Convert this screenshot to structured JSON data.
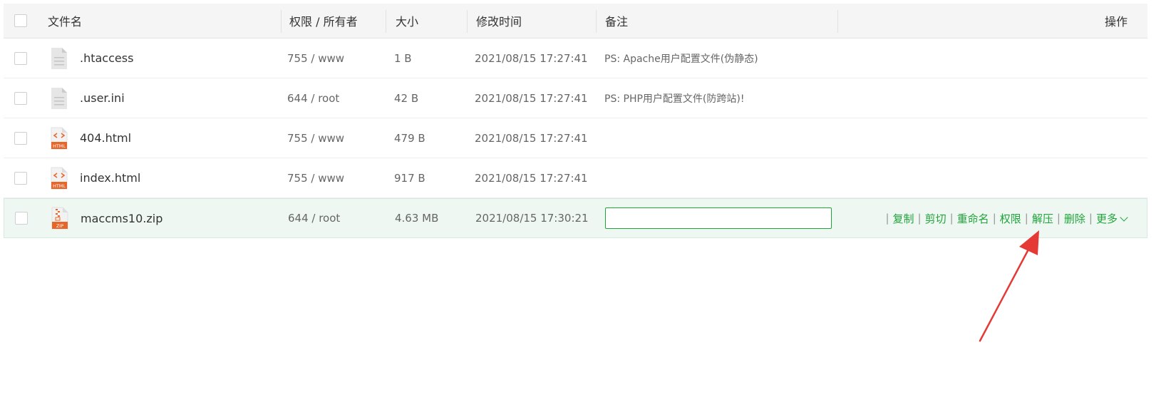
{
  "header": {
    "name": "文件名",
    "perm": "权限 / 所有者",
    "size": "大小",
    "time": "修改时间",
    "note": "备注",
    "ops": "操作"
  },
  "rows": [
    {
      "icon": "text-file-icon",
      "name": ".htaccess",
      "perm": "755 / www",
      "size": "1 B",
      "time": "2021/08/15 17:27:41",
      "note": "PS: Apache用户配置文件(伪静态)"
    },
    {
      "icon": "text-file-icon",
      "name": ".user.ini",
      "perm": "644 / root",
      "size": "42 B",
      "time": "2021/08/15 17:27:41",
      "note": "PS: PHP用户配置文件(防跨站)!"
    },
    {
      "icon": "html-file-icon",
      "icon_label": "HTML",
      "name": "404.html",
      "perm": "755 / www",
      "size": "479 B",
      "time": "2021/08/15 17:27:41",
      "note": ""
    },
    {
      "icon": "html-file-icon",
      "icon_label": "HTML",
      "name": "index.html",
      "perm": "755 / www",
      "size": "917 B",
      "time": "2021/08/15 17:27:41",
      "note": ""
    },
    {
      "icon": "zip-file-icon",
      "icon_label": "ZIP",
      "name": "maccms10.zip",
      "perm": "644 / root",
      "size": "4.63 MB",
      "time": "2021/08/15 17:30:21",
      "note_input_value": ""
    }
  ],
  "ops": {
    "copy": "复制",
    "cut": "剪切",
    "rename": "重命名",
    "perm": "权限",
    "extract": "解压",
    "delete": "删除",
    "more": "更多",
    "separator": "|"
  },
  "colors": {
    "accent": "#20a53a",
    "arrow": "#e53935",
    "html_icon": "#e8652a",
    "text_icon": "#dcdcdc"
  }
}
